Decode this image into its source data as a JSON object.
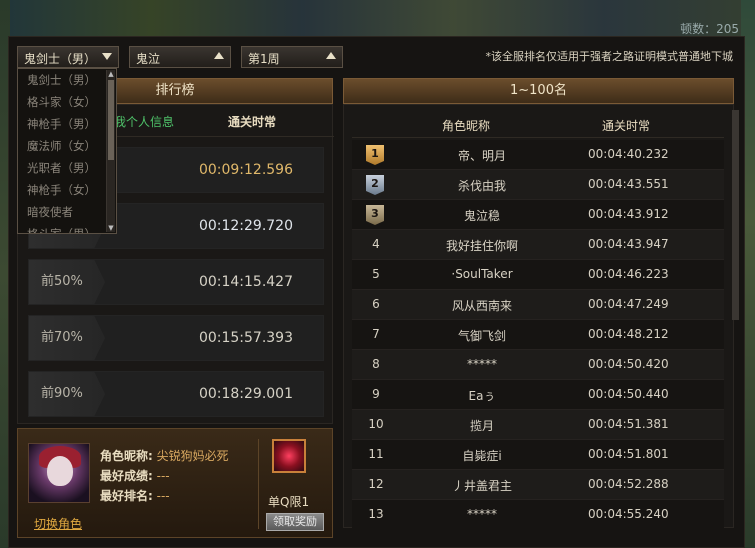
{
  "background": {
    "top_count": "顿数：205"
  },
  "filters": {
    "job": "鬼剑士（男）",
    "dungeon": "鬼泣",
    "week": "第1周",
    "note": "*该全服排名仅适用于强者之路证明模式普通地下城"
  },
  "job_options": [
    "鬼剑士（男）",
    "格斗家（女）",
    "神枪手（男）",
    "魔法师（女）",
    "光职者（男）",
    "神枪手（女）",
    "暗夜使者",
    "格斗家（男）"
  ],
  "left": {
    "title": "排行榜",
    "col_personal": "我个人信息",
    "col_time": "通关时常",
    "rows": [
      {
        "tag": "",
        "time": "00:09:12.596"
      },
      {
        "tag": "",
        "time": "00:12:29.720"
      },
      {
        "tag": "前50%",
        "time": "00:14:15.427"
      },
      {
        "tag": "前70%",
        "time": "00:15:57.393"
      },
      {
        "tag": "前90%",
        "time": "00:18:29.001"
      }
    ]
  },
  "character": {
    "nickname_label": "角色昵称:",
    "nickname": "尖锐狗妈必死",
    "best_score_label": "最好成绩:",
    "best_score": "---",
    "best_rank_label": "最好排名:",
    "best_rank": "---",
    "switch_label": "切换角色",
    "reward_label": "单Q限1",
    "claim_label": "领取奖励"
  },
  "right": {
    "title": "1~100名",
    "col_name": "角色昵称",
    "col_time": "通关时常",
    "rows": [
      {
        "rank": "1",
        "name": "帝、明月",
        "time": "00:04:40.232"
      },
      {
        "rank": "2",
        "name": "杀伐由我",
        "time": "00:04:43.551"
      },
      {
        "rank": "3",
        "name": "鬼泣稳",
        "time": "00:04:43.912"
      },
      {
        "rank": "4",
        "name": "我好挂住你啊",
        "time": "00:04:43.947"
      },
      {
        "rank": "5",
        "name": "·SoulTaker",
        "time": "00:04:46.223"
      },
      {
        "rank": "6",
        "name": "风从西南来",
        "time": "00:04:47.249"
      },
      {
        "rank": "7",
        "name": "气御飞剑",
        "time": "00:04:48.212"
      },
      {
        "rank": "8",
        "name": "*****",
        "time": "00:04:50.420"
      },
      {
        "rank": "9",
        "name": "Eaぅ",
        "time": "00:04:50.440"
      },
      {
        "rank": "10",
        "name": "揽月",
        "time": "00:04:51.381"
      },
      {
        "rank": "11",
        "name": "自毙症i",
        "time": "00:04:51.801"
      },
      {
        "rank": "12",
        "name": "丿井盖君主",
        "time": "00:04:52.288"
      },
      {
        "rank": "13",
        "name": "*****",
        "time": "00:04:55.240"
      }
    ]
  },
  "colors": {
    "accent": "#e0b86a",
    "header": "#6b4d2c",
    "link": "#4fc36a"
  }
}
